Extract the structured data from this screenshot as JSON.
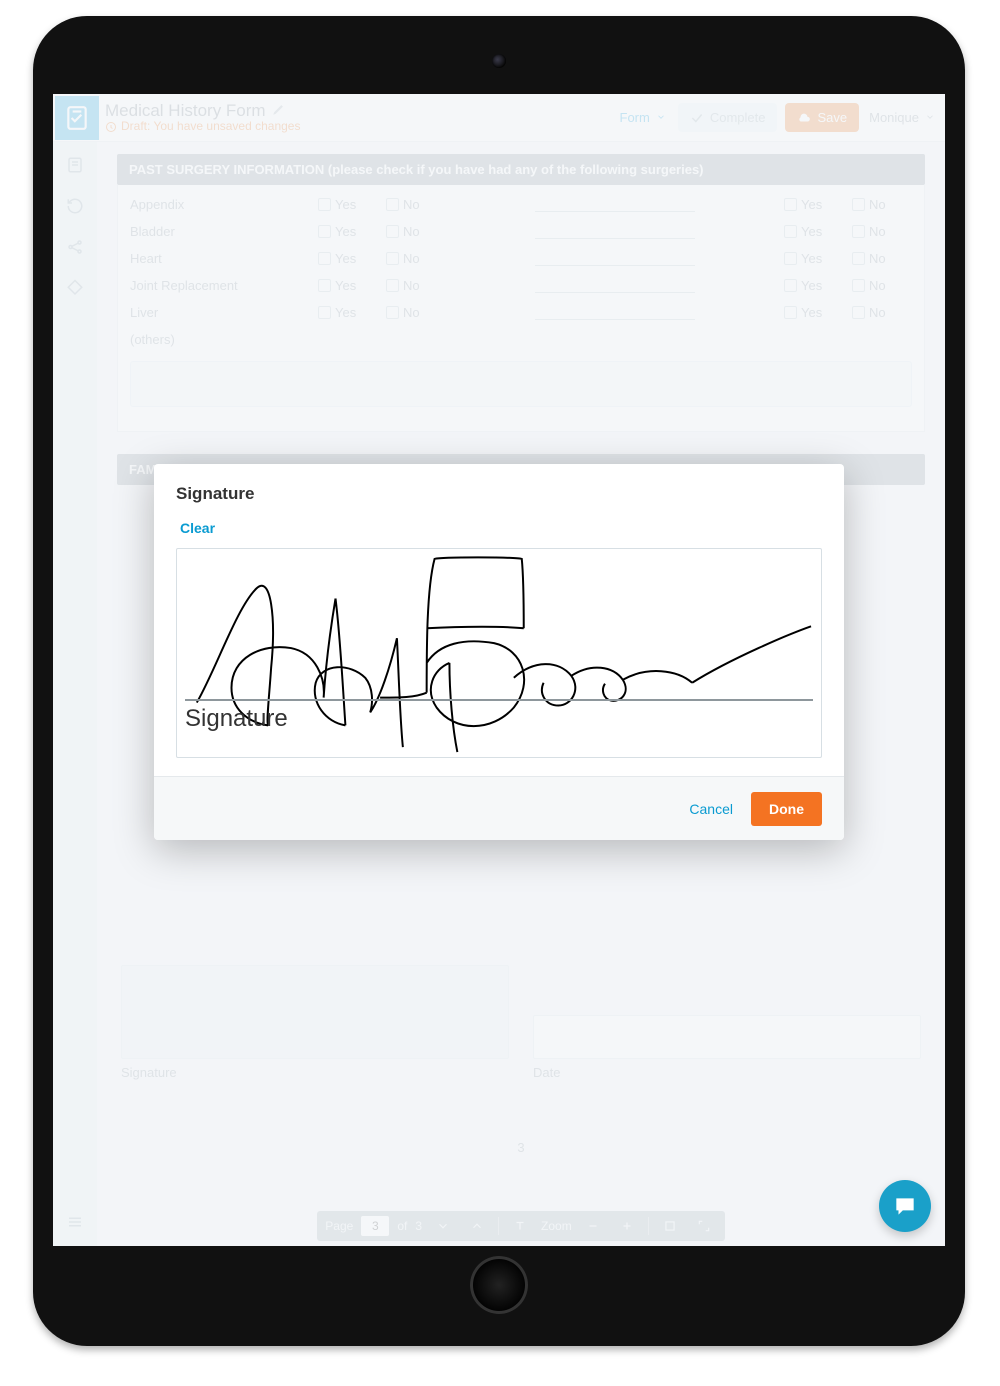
{
  "header": {
    "title": "Medical History Form",
    "draft_text": "Draft: You have unsaved changes",
    "form_label": "Form",
    "complete_label": "Complete",
    "save_label": "Save",
    "user_name": "Monique"
  },
  "section_surgery_title": "PAST SURGERY INFORMATION (please check if you have had any of the following surgeries)",
  "yes_label": "Yes",
  "no_label": "No",
  "surgery_rows": [
    "Appendix",
    "Bladder",
    "Heart",
    "Joint Replacement",
    "Liver"
  ],
  "others_label": "(others)",
  "section_family_title": "FAMILY MEDICAL HISTORY INFORMATION (please check if the following exists in your family)",
  "sig_field_label": "Signature",
  "date_field_label": "Date",
  "page_number": "3",
  "toolbar": {
    "page_label": "Page",
    "of_label": "of",
    "total_pages": "3",
    "current_page": "3",
    "zoom_label": "Zoom"
  },
  "modal": {
    "title": "Signature",
    "clear_label": "Clear",
    "placeholder": "Signature",
    "cancel_label": "Cancel",
    "done_label": "Done"
  }
}
